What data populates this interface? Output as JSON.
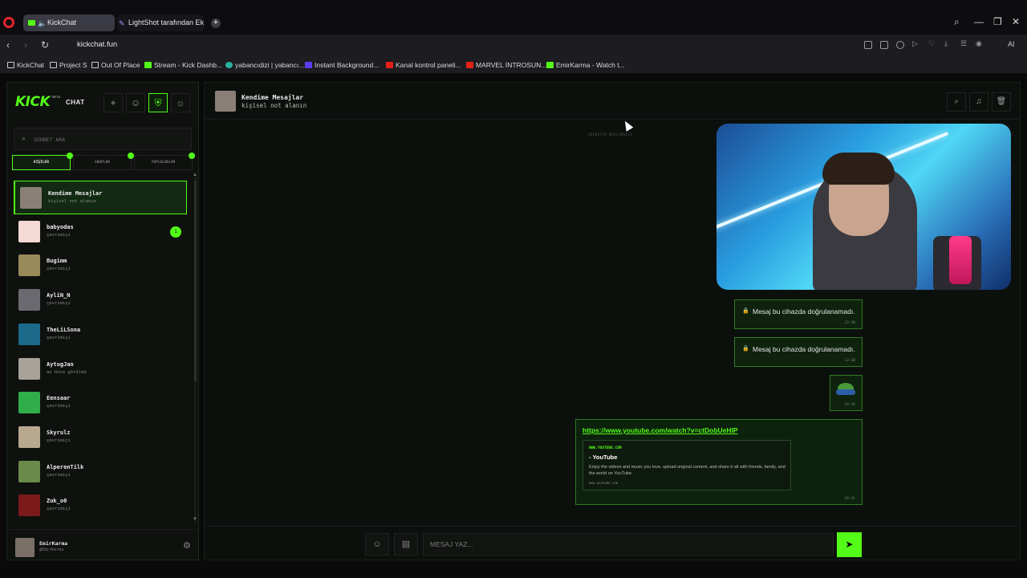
{
  "browser": {
    "tabs": [
      {
        "label": "KickChat",
        "active": true
      },
      {
        "label": "LightShot tarafından Ekran",
        "active": false
      }
    ],
    "url": "kickchat.fun",
    "ai_label": "AI",
    "bookmarks": [
      {
        "label": "KickChat",
        "icon": "folder-icon"
      },
      {
        "label": "Project S",
        "icon": "folder-icon"
      },
      {
        "label": "Out Of Place",
        "icon": "folder-icon"
      },
      {
        "label": "Stream - Kick Dashb...",
        "icon": "kick-icon"
      },
      {
        "label": "yabancıdizi | yabancı...",
        "icon": "site-icon"
      },
      {
        "label": "Instant Background...",
        "icon": "site-icon"
      },
      {
        "label": "Kanal kontrol paneli...",
        "icon": "youtube-icon"
      },
      {
        "label": "MARVEL İNTROSUN...",
        "icon": "youtube-icon"
      },
      {
        "label": "EmirKarma - Watch t...",
        "icon": "kick-icon"
      }
    ]
  },
  "sidebar": {
    "logo": "KICK",
    "logo_badge": "BETA",
    "logo_suffix": "CHAT",
    "search_placeholder": "SOHBET ARA",
    "categories": [
      {
        "label": "KİŞİLER",
        "active": true
      },
      {
        "label": "GRUPLAR",
        "active": false
      },
      {
        "label": "TOPLULUKLAR",
        "active": false
      }
    ],
    "contacts": [
      {
        "name": "Kendime Mesajlar",
        "status": "kişisel not alanın",
        "active": true,
        "badge": "",
        "color": "#8a7f76"
      },
      {
        "name": "babyodas",
        "status": "çevrimiçi",
        "active": false,
        "badge": "1",
        "color": "#f4d9d4"
      },
      {
        "name": "Bugimm",
        "status": "çevrimiçi",
        "active": false,
        "badge": "",
        "color": "#9a8a5a"
      },
      {
        "name": "AyliN_N",
        "status": "çevrimiçi",
        "active": false,
        "badge": "",
        "color": "#6a6a70"
      },
      {
        "name": "TheLiLSona",
        "status": "çevrimiçi",
        "active": false,
        "badge": "",
        "color": "#1b6a8a"
      },
      {
        "name": "AytugJan",
        "status": "az önce görüldü",
        "active": false,
        "badge": "",
        "color": "#a8a29a"
      },
      {
        "name": "Eensaar",
        "status": "çevrimiçi",
        "active": false,
        "badge": "",
        "color": "#2fae4a"
      },
      {
        "name": "Skyrulz",
        "status": "çevrimiçi",
        "active": false,
        "badge": "",
        "color": "#b8a890"
      },
      {
        "name": "AlperenTilk",
        "status": "çevrimiçi",
        "active": false,
        "badge": "",
        "color": "#6a8a4a"
      },
      {
        "name": "Zuk_o0",
        "status": "çevrimiçi",
        "active": false,
        "badge": "",
        "color": "#7a1a1a"
      }
    ],
    "me": {
      "name": "EmirKarma",
      "handle": "@EmirKarma"
    }
  },
  "chat": {
    "title": "Kendime Mesajlar",
    "subtitle": "kişisel not alanın",
    "start_label": "SOHBETİN BAŞLANGICI",
    "messages": [
      {
        "kind": "locked",
        "text": "Mesaj bu cihazda doğrulanamadı.",
        "time": "13:30"
      },
      {
        "kind": "locked",
        "text": "Mesaj bu cihazda doğrulanamadı.",
        "time": "13:30"
      },
      {
        "kind": "sticker",
        "time": "19:36"
      },
      {
        "kind": "link",
        "url": "https://www.youtube.com/watch?v=ctDobUeHIP",
        "embed_site": "WWW.YOUTUBE.COM",
        "embed_title": "- YouTube",
        "embed_desc": "Enjoy the videos and music you love, upload original content, and share it all with friends, family, and the world on YouTube.",
        "embed_foot": "www.youtube.com",
        "time": "19:41"
      }
    ],
    "composer_placeholder": "MESAJ YAZ..."
  },
  "colors": {
    "accent": "#53fc18",
    "bg": "#0a0a0a"
  }
}
